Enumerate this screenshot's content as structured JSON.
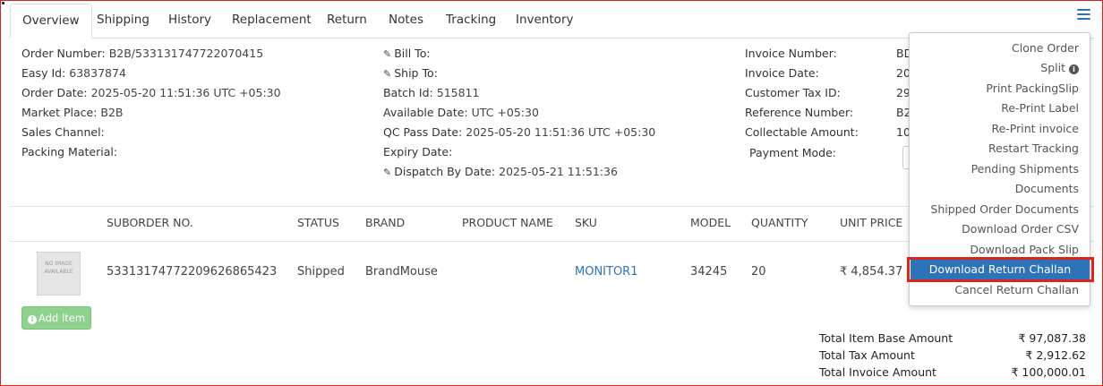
{
  "tabs": [
    "Overview",
    "Shipping",
    "History",
    "Replacement",
    "Return",
    "Notes",
    "Tracking",
    "Inventory"
  ],
  "order": {
    "order_number_label": "Order Number:",
    "order_number": "B2B/533131747722070415",
    "easy_id_label": "Easy Id:",
    "easy_id": "63837874",
    "order_date_label": "Order Date:",
    "order_date": "2025-05-20 11:51:36 UTC +05:30",
    "market_place_label": "Market Place:",
    "market_place": "B2B",
    "sales_channel_label": "Sales Channel:",
    "packing_material_label": "Packing Material:"
  },
  "shipment": {
    "bill_to_label": "Bill To:",
    "ship_to_label": "Ship To:",
    "batch_id_label": "Batch Id:",
    "batch_id": "515811",
    "available_date_label": "Available Date:",
    "available_date": "UTC +05:30",
    "qc_pass_date_label": "QC Pass Date:",
    "qc_pass_date": "2025-05-20 11:51:36 UTC +05:30",
    "expiry_date_label": "Expiry Date:",
    "dispatch_by_date_label": "Dispatch By Date:",
    "dispatch_by_date": "2025-05-21 11:51:36"
  },
  "invoice": {
    "invoice_number_label": "Invoice Number:",
    "invoice_number": "BD",
    "invoice_date_label": "Invoice Date:",
    "invoice_date": "20",
    "customer_tax_id_label": "Customer Tax ID:",
    "customer_tax_id": "29",
    "reference_number_label": "Reference Number:",
    "reference_number": "B2",
    "collectable_amount_label": "Collectable Amount:",
    "collectable_amount": "10",
    "payment_mode_label": "Payment Mode:"
  },
  "table": {
    "headers": [
      "SUBORDER NO.",
      "STATUS",
      "BRAND",
      "PRODUCT NAME",
      "SKU",
      "MODEL",
      "QUANTITY",
      "UNIT PRICE"
    ],
    "row": {
      "image_text": "NO IMAGE AVAILABLE",
      "suborder_no": "5331317477220962686542 3",
      "status": "Shipped",
      "brand": "BrandMouse",
      "product_name": "",
      "sku": "MONITOR1",
      "model": "34245",
      "quantity": "20",
      "unit_price": "₹ 4,854.37"
    }
  },
  "add_item_label": "Add Item",
  "totals": [
    {
      "label": "Total Item Base Amount",
      "value": "₹ 97,087.38"
    },
    {
      "label": "Total Tax Amount",
      "value": "₹ 2,912.62"
    },
    {
      "label": "Total Invoice Amount",
      "value": "₹ 100,000.01"
    }
  ],
  "dropdown": {
    "items": [
      "Clone Order",
      "Split",
      "Print PackingSlip",
      "Re-Print Label",
      "Re-Print invoice",
      "Restart Tracking",
      "Pending Shipments",
      "Documents",
      "Shipped Order Documents",
      "Download Order CSV",
      "Download Pack Slip",
      "Download Return Challan",
      "Cancel Return Challan"
    ],
    "highlighted": "Download Return Challan"
  },
  "colors": {
    "accent": "#2e73b8",
    "highlight_border": "#d9251d",
    "success": "#8fd18f"
  },
  "icons": [
    "menu-icon",
    "pencil-icon",
    "info-icon",
    "no-image-placeholder"
  ]
}
